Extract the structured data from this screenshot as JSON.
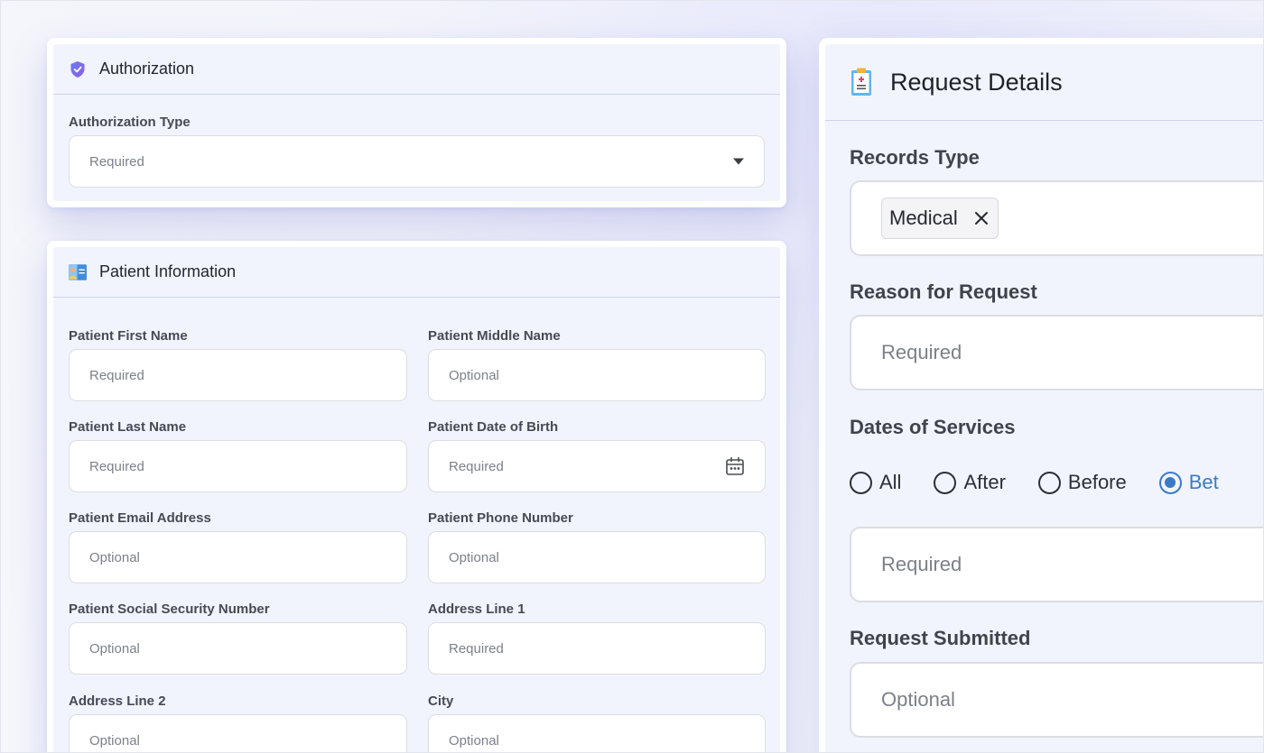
{
  "authorization": {
    "title": "Authorization",
    "type_label": "Authorization Type",
    "type_placeholder": "Required"
  },
  "patient": {
    "title": "Patient Information",
    "fields": [
      {
        "label": "Patient First Name",
        "placeholder": "Required"
      },
      {
        "label": "Patient Middle Name",
        "placeholder": "Optional"
      },
      {
        "label": "Patient Last Name",
        "placeholder": "Required"
      },
      {
        "label": "Patient Date of Birth",
        "placeholder": "Required"
      },
      {
        "label": "Patient Email Address",
        "placeholder": "Optional"
      },
      {
        "label": "Patient Phone Number",
        "placeholder": "Optional"
      },
      {
        "label": "Patient Social Security Number",
        "placeholder": "Optional"
      },
      {
        "label": "Address Line 1",
        "placeholder": "Required"
      },
      {
        "label": "Address Line 2",
        "placeholder": "Optional"
      },
      {
        "label": "City",
        "placeholder": "Optional"
      }
    ]
  },
  "request": {
    "title": "Request Details",
    "records_type_label": "Records Type",
    "records_type_chip": "Medical",
    "reason_label": "Reason for Request",
    "reason_placeholder": "Required",
    "dates_label": "Dates of Services",
    "date_options": [
      "All",
      "After",
      "Before",
      "Bet"
    ],
    "selected_option": "Bet",
    "dates_placeholder": "Required",
    "submitted_label": "Request Submitted",
    "submitted_placeholder": "Optional"
  },
  "colors": {
    "accent": "#3a7ac8",
    "panel": "#f2f4fd",
    "divider": "#cfd2f2"
  },
  "icons": {
    "authorization": "shield-check-icon",
    "patient": "id-card-icon",
    "request": "clipboard-icon",
    "dropdown": "caret-down-icon",
    "date": "calendar-icon",
    "chip_remove": "close-icon"
  }
}
